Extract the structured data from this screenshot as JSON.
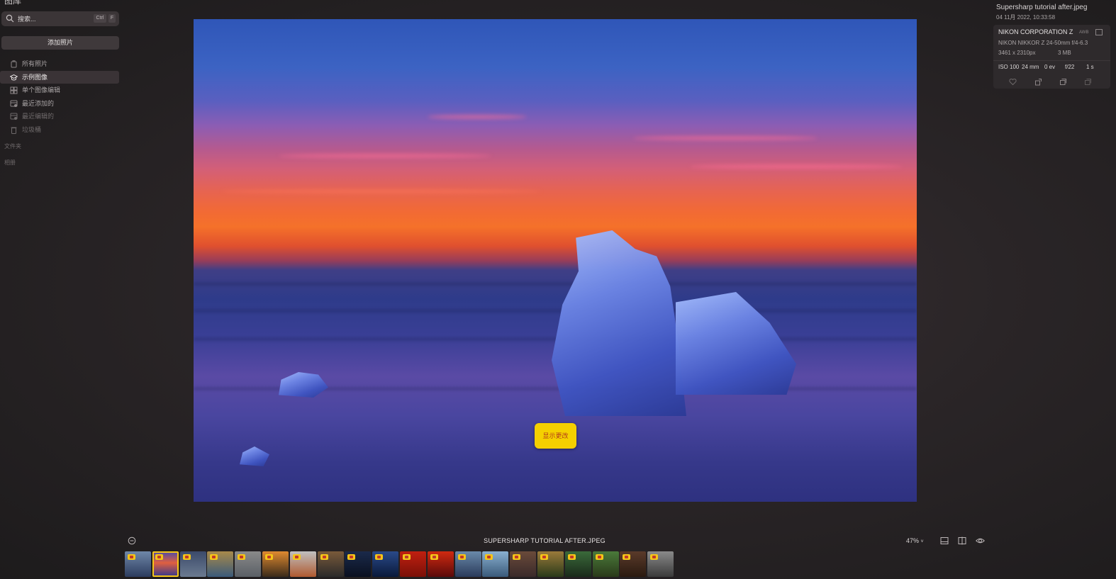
{
  "sidebar": {
    "app_title": "图库",
    "search": {
      "placeholder": "搜索...",
      "shortcut_1": "Ctrl",
      "shortcut_2": "F"
    },
    "add_photos_label": "添加照片",
    "items": [
      {
        "label": "所有照片",
        "icon": "photo-stack-icon",
        "state": "normal"
      },
      {
        "label": "示例图像",
        "icon": "graduation-cap-icon",
        "state": "active"
      },
      {
        "label": "单个图像编辑",
        "icon": "grid-icon",
        "state": "normal"
      },
      {
        "label": "最近添加的",
        "icon": "recent-added-icon",
        "state": "normal"
      },
      {
        "label": "最近编辑的",
        "icon": "recent-edited-icon",
        "state": "dim"
      },
      {
        "label": "垃圾桶",
        "icon": "trash-icon",
        "state": "dim"
      }
    ],
    "section_folders": "文件夹",
    "section_albums": "相册"
  },
  "viewer": {
    "show_changes_label": "显示更改"
  },
  "info_panel": {
    "filename": "Supersharp tutorial after.jpeg",
    "date": "04 11月 2022, 10:33:58",
    "camera_maker": "NIKON CORPORATION Z",
    "awb": "AWB",
    "lens": "NIKON NIKKOR Z 24-50mm f/4-6.3",
    "resolution": "3461 x 2310px",
    "file_size": "3 MB",
    "iso": "ISO 100",
    "focal_length": "24 mm",
    "exposure_comp": "0 ev",
    "aperture": "f/22",
    "shutter": "1 s"
  },
  "bottom_bar": {
    "title": "SUPERSHARP TUTORIAL AFTER.JPEG",
    "zoom_label": "47%",
    "selected_index": 1,
    "thumb_count": 20
  },
  "colors": {
    "accent_yellow": "#f5d000",
    "selection_outline": "#f5c518",
    "background": "#2a2527"
  }
}
